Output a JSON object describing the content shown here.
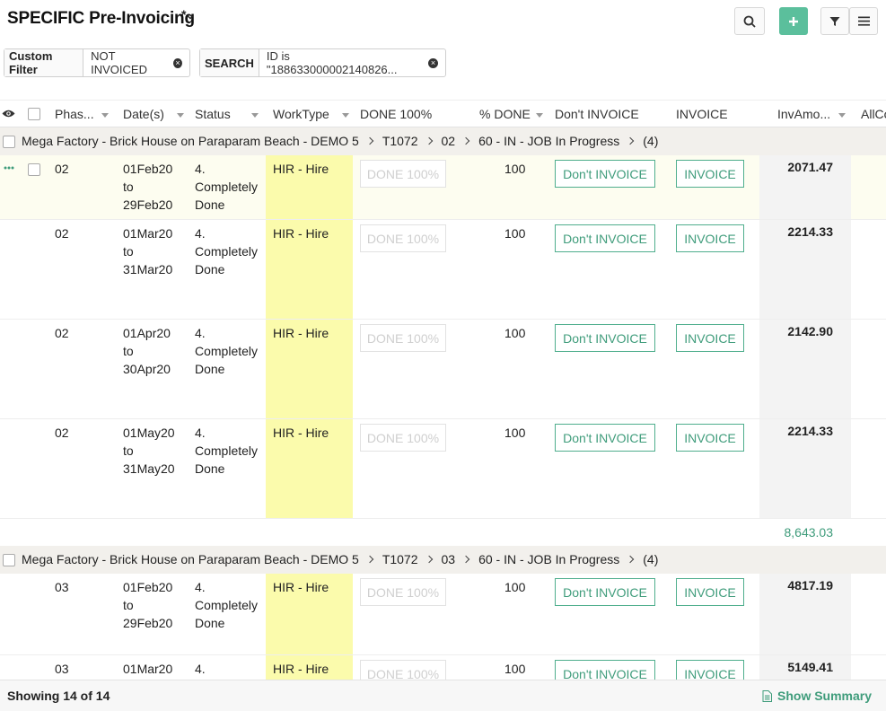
{
  "header": {
    "title": "SPECIFIC Pre-Invoicing",
    "modified_marker": "*"
  },
  "filters": {
    "custom_label": "Custom Filter",
    "custom_value": "NOT INVOICED",
    "search_label": "SEARCH",
    "search_value": "ID is \"188633000002140826..."
  },
  "columns": {
    "phase": "Phas...",
    "dates": "Date(s)",
    "status": "Status",
    "worktype": "WorkType",
    "done100": "DONE 100%",
    "pct_done": "% DONE",
    "dont_invoice": "Don't INVOICE",
    "invoice": "INVOICE",
    "inv_amount": "InvAmo...",
    "allc": "AllCo"
  },
  "groups": [
    {
      "name": "Mega Factory - Brick House on Paraparam Beach - DEMO 5",
      "job": "T1072",
      "phase": "02",
      "stage": "60 - IN - JOB In Progress",
      "count": "(4)",
      "subtotal": "8,643.03",
      "rows": [
        {
          "phase": "02",
          "date_from": "01Feb20",
          "date_to_word": "to",
          "date_to": "29Feb20",
          "status_1": "4.",
          "status_2": "Completely",
          "status_3": "Done",
          "worktype": "HIR - Hire",
          "done_btn": "DONE 100%",
          "pct": "100",
          "dont_btn": "Don't INVOICE",
          "inv_btn": "INVOICE",
          "amount": "2071.47"
        },
        {
          "phase": "02",
          "date_from": "01Mar20",
          "date_to_word": "to",
          "date_to": "31Mar20",
          "status_1": "4.",
          "status_2": "Completely",
          "status_3": "Done",
          "worktype": "HIR - Hire",
          "done_btn": "DONE 100%",
          "pct": "100",
          "dont_btn": "Don't INVOICE",
          "inv_btn": "INVOICE",
          "amount": "2214.33"
        },
        {
          "phase": "02",
          "date_from": "01Apr20",
          "date_to_word": "to",
          "date_to": "30Apr20",
          "status_1": "4.",
          "status_2": "Completely",
          "status_3": "Done",
          "worktype": "HIR - Hire",
          "done_btn": "DONE 100%",
          "pct": "100",
          "dont_btn": "Don't INVOICE",
          "inv_btn": "INVOICE",
          "amount": "2142.90"
        },
        {
          "phase": "02",
          "date_from": "01May20",
          "date_to_word": "to",
          "date_to": "31May20",
          "status_1": "4.",
          "status_2": "Completely",
          "status_3": "Done",
          "worktype": "HIR - Hire",
          "done_btn": "DONE 100%",
          "pct": "100",
          "dont_btn": "Don't INVOICE",
          "inv_btn": "INVOICE",
          "amount": "2214.33"
        }
      ]
    },
    {
      "name": "Mega Factory - Brick House on Paraparam Beach - DEMO 5",
      "job": "T1072",
      "phase": "03",
      "stage": "60 - IN - JOB In Progress",
      "count": "(4)",
      "rows": [
        {
          "phase": "03",
          "date_from": "01Feb20",
          "date_to_word": "to",
          "date_to": "29Feb20",
          "status_1": "4.",
          "status_2": "Completely",
          "status_3": "Done",
          "worktype": "HIR - Hire",
          "done_btn": "DONE 100%",
          "pct": "100",
          "dont_btn": "Don't INVOICE",
          "inv_btn": "INVOICE",
          "amount": "4817.19"
        },
        {
          "phase": "03",
          "date_from": "01Mar20",
          "date_to_word": "",
          "date_to": "",
          "status_1": "4.",
          "status_2": "",
          "status_3": "",
          "worktype": "HIR - Hire",
          "done_btn": "DONE 100%",
          "pct": "100",
          "dont_btn": "Don't INVOICE",
          "inv_btn": "INVOICE",
          "amount": "5149.41"
        }
      ]
    }
  ],
  "footer": {
    "count_text": "Showing 14 of 14",
    "summary_label": "Show Summary"
  },
  "colors": {
    "accent": "#5bbf9c",
    "worktype_highlight": "#fbfbac",
    "group_bg": "#f2f0ec"
  }
}
